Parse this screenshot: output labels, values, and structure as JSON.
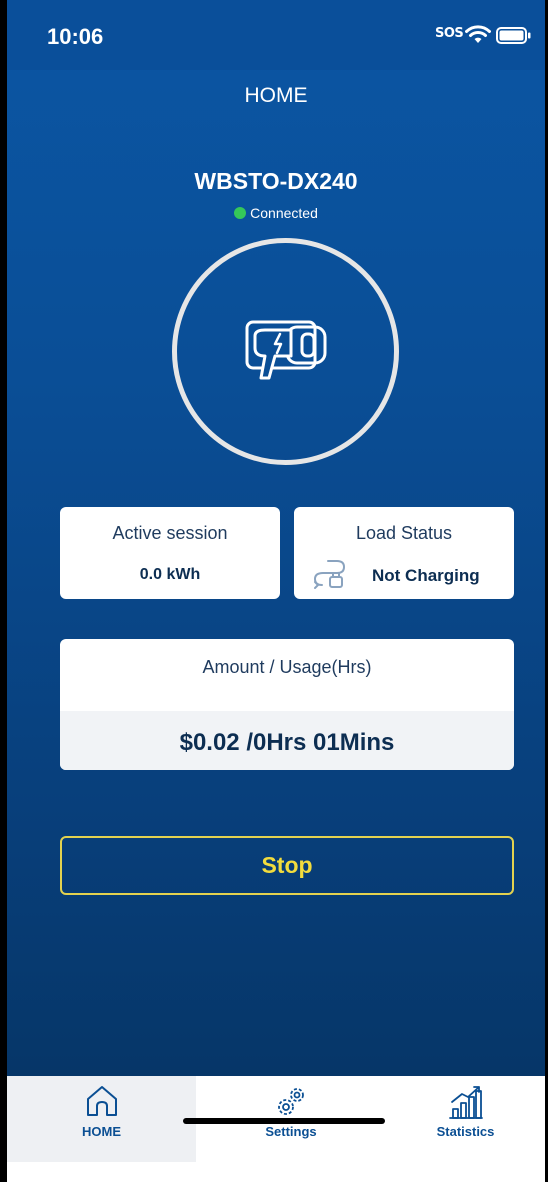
{
  "status_bar": {
    "time": "10:06",
    "sos_label": "SOS",
    "icons": [
      "wifi-icon",
      "battery-icon"
    ]
  },
  "header": {
    "title": "HOME"
  },
  "device": {
    "name": "WBSTO-DX240",
    "connection_status": "Connected",
    "connection_color": "#35c759",
    "icon": "ev-charger-plug-icon"
  },
  "cards": {
    "active_session": {
      "label": "Active session",
      "value": "0.0 kWh"
    },
    "load_status": {
      "label": "Load Status",
      "value": "Not Charging",
      "icon": "cable-plug-icon"
    },
    "amount_usage": {
      "label": "Amount / Usage(Hrs)",
      "value": "$0.02 /0Hrs 01Mins"
    }
  },
  "actions": {
    "stop_label": "Stop",
    "stop_color": "#f2dc3d"
  },
  "tab_bar": {
    "items": [
      {
        "label": "HOME",
        "icon": "home-icon",
        "active": true
      },
      {
        "label": "Settings",
        "icon": "gears-icon",
        "active": false
      },
      {
        "label": "Statistics",
        "icon": "bar-chart-icon",
        "active": false
      }
    ]
  },
  "colors": {
    "background": "#0a4e96",
    "accent": "#0b4f93",
    "card": "#ffffff"
  }
}
